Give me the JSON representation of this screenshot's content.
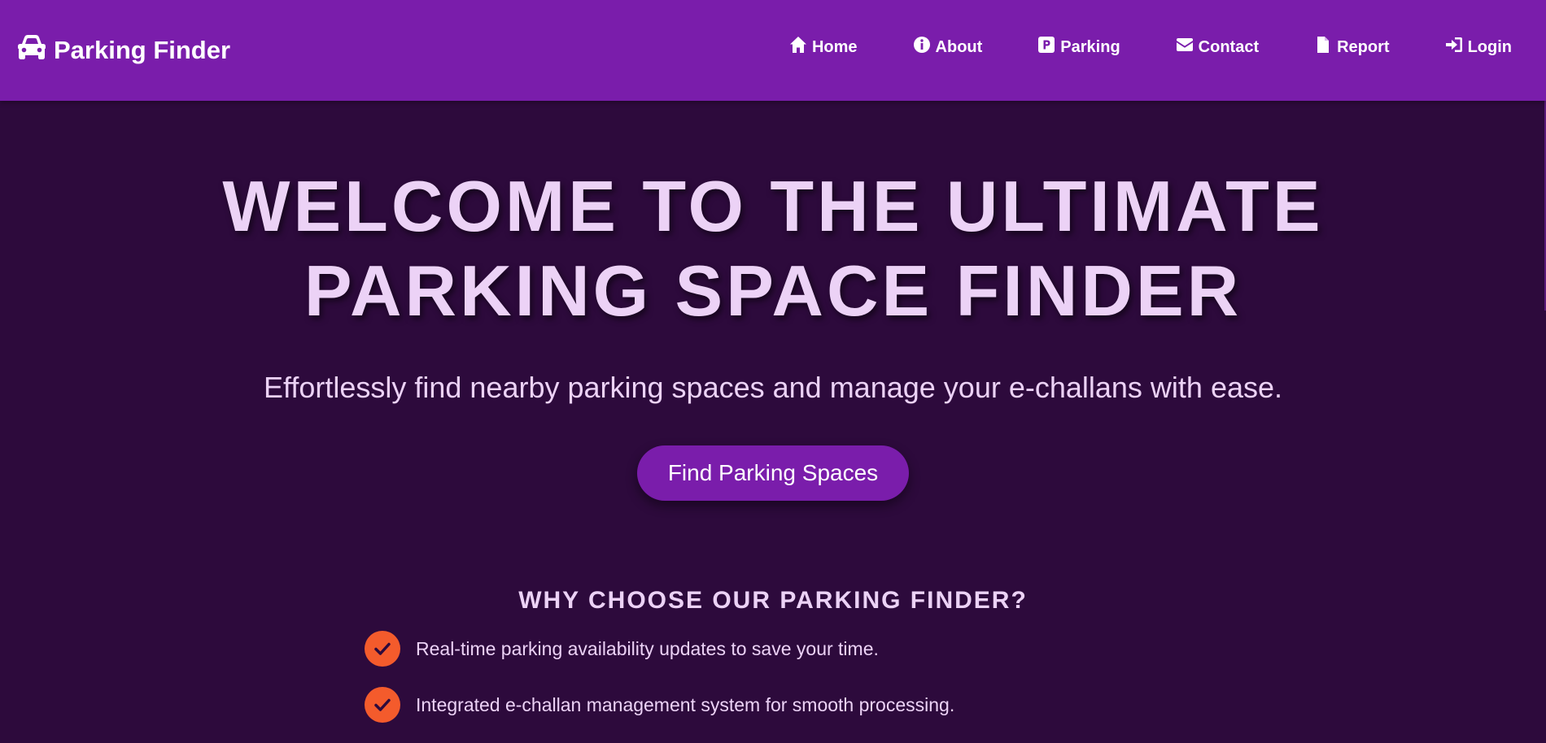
{
  "navbar": {
    "brand": "Parking Finder",
    "brand_icon": "car-icon",
    "links": [
      {
        "label": "Home",
        "icon": "home-icon"
      },
      {
        "label": "About",
        "icon": "info-icon"
      },
      {
        "label": "Parking",
        "icon": "parking-icon"
      },
      {
        "label": "Contact",
        "icon": "envelope-icon"
      },
      {
        "label": "Report",
        "icon": "file-icon"
      },
      {
        "label": "Login",
        "icon": "sign-in-icon"
      }
    ]
  },
  "hero": {
    "title": "WELCOME TO THE ULTIMATE PARKING SPACE FINDER",
    "subtitle": "Effortlessly find nearby parking spaces and manage your e-challans with ease.",
    "cta_label": "Find Parking Spaces"
  },
  "features": {
    "title": "WHY CHOOSE OUR PARKING FINDER?",
    "items": [
      "Real-time parking availability updates to save your time.",
      "Integrated e-challan management system for smooth processing."
    ]
  },
  "colors": {
    "navbar_bg": "#7a1dab",
    "page_bg": "#2d0a3c",
    "text_light": "#ecd2f6",
    "check_bg": "#f45b2c"
  }
}
